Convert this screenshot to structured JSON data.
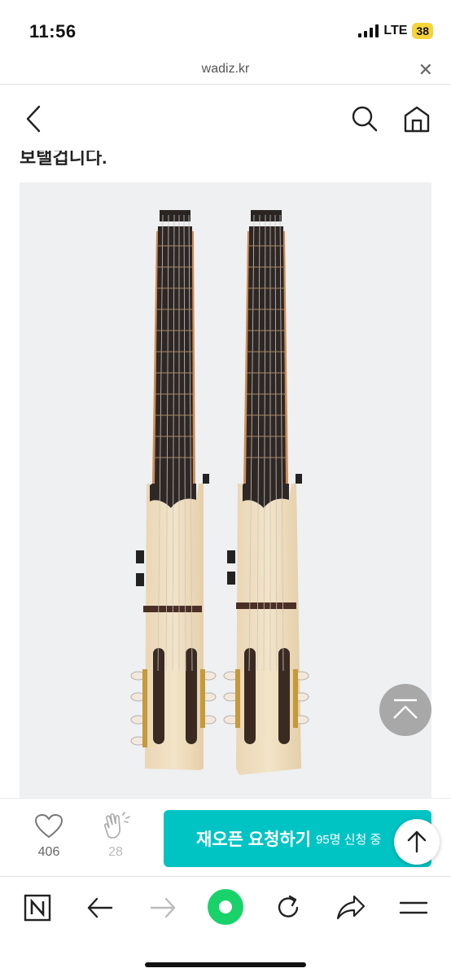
{
  "status_bar": {
    "time": "11:56",
    "network": "LTE",
    "battery": "38"
  },
  "url_bar": {
    "domain": "wadiz.kr",
    "close": "✕"
  },
  "page_header": {
    "back_icon": "chevron-left-icon",
    "search_icon": "search-icon",
    "home_icon": "home-icon"
  },
  "content": {
    "cut_off_text": "보탤겁니다."
  },
  "product_image": {
    "subject": "two headless travel guitars",
    "background": "#eef0f2"
  },
  "action_bar": {
    "likes": "406",
    "claps": "28",
    "reopen_label": "재오픈 요청하기",
    "reopen_count": "95명 신청 중",
    "button_color": "#00c4c4"
  },
  "browser_bar": {
    "icons": [
      "naver-n-icon",
      "back-arrow-icon",
      "forward-arrow-icon",
      "green-dot-icon",
      "refresh-icon",
      "share-icon",
      "menu-icon"
    ],
    "accent": "#19d36a"
  }
}
